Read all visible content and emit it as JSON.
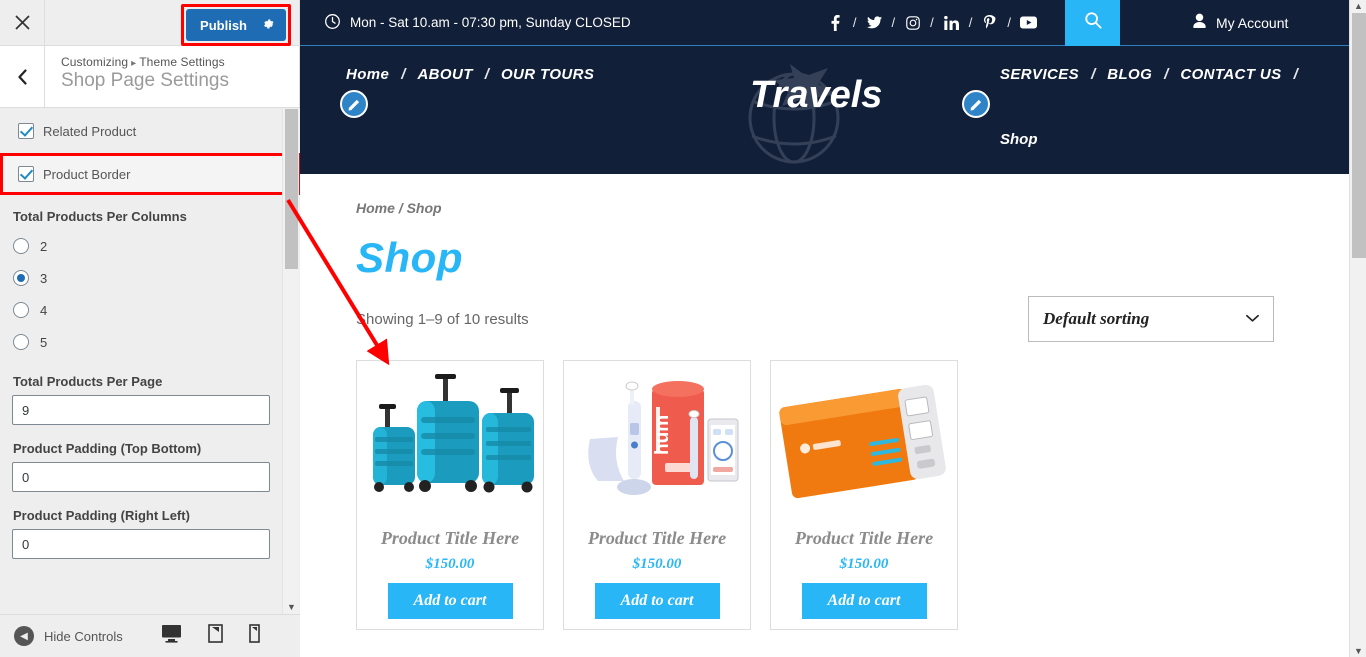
{
  "customizer": {
    "close_label": "✕",
    "publish_label": "Publish",
    "gear_icon": "gear-icon",
    "back_label": "‹",
    "breadcrumb_root": "Customizing",
    "breadcrumb_sep": "▸",
    "breadcrumb_parent": "Theme Settings",
    "panel_title": "Shop Page Settings",
    "checkboxes": [
      {
        "label": "Related Product",
        "checked": true,
        "highlighted": false
      },
      {
        "label": "Product Border",
        "checked": true,
        "highlighted": true
      }
    ],
    "columns_group": {
      "title": "Total Products Per Columns",
      "options": [
        {
          "label": "2",
          "selected": false
        },
        {
          "label": "3",
          "selected": true
        },
        {
          "label": "4",
          "selected": false
        },
        {
          "label": "5",
          "selected": false
        }
      ]
    },
    "fields": [
      {
        "label": "Total Products Per Page",
        "value": "9"
      },
      {
        "label": "Product Padding (Top Bottom)",
        "value": "0"
      },
      {
        "label": "Product Padding (Right Left)",
        "value": "0"
      }
    ],
    "footer": {
      "hide_controls_label": "Hide Controls",
      "devices": [
        {
          "name": "desktop",
          "active": true
        },
        {
          "name": "tablet",
          "active": false
        },
        {
          "name": "mobile",
          "active": false
        }
      ]
    },
    "accent_publish": "#1e6cb3",
    "highlight_color": "#ff0000"
  },
  "site": {
    "topbar": {
      "clock_icon": "clock-icon",
      "hours": "Mon - Sat 10.am - 07:30 pm, Sunday CLOSED",
      "socials": [
        "facebook",
        "twitter",
        "instagram",
        "linkedin",
        "pinterest",
        "youtube"
      ],
      "social_separator": "/",
      "search_icon": "search-icon",
      "account_icon": "user-icon",
      "account_label": "My Account",
      "search_bg": "#29b6f6",
      "bar_bg": "#111f38"
    },
    "nav": {
      "left_items": [
        "Home",
        "ABOUT",
        "OUR TOURS"
      ],
      "right_items": [
        "SERVICES",
        "BLOG",
        "CONTACT US"
      ],
      "separator": "/",
      "sub_item": "Shop",
      "brand": "Travels",
      "edit_icon": "pencil-icon"
    },
    "shop": {
      "breadcrumb": "Home / Shop",
      "title": "Shop",
      "result_count": "Showing 1–9 of 10 results",
      "sorting_selected": "Default sorting",
      "sorting_chevron": "chevron-down-icon",
      "title_color": "#29b6f6",
      "products": [
        {
          "image": "teal-luggage-set",
          "title": "Product Title Here",
          "price": "$150.00",
          "cart_label": "Add to cart",
          "bordered": true
        },
        {
          "image": "electric-toothbrush-kit",
          "title": "Product Title Here",
          "price": "$150.00",
          "cart_label": "Add to cart",
          "bordered": true
        },
        {
          "image": "orange-power-bank",
          "title": "Product Title Here",
          "price": "$150.00",
          "cart_label": "Add to cart",
          "bordered": true
        }
      ]
    }
  }
}
